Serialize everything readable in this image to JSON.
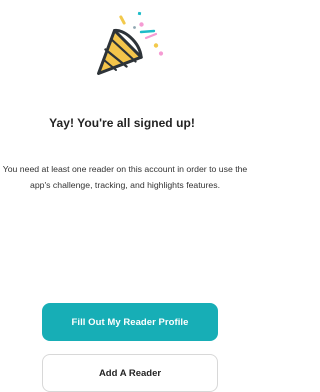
{
  "hero": {
    "icon": "party-popper-icon"
  },
  "content": {
    "title": "Yay! You're all signed up!",
    "message": "You need at least one reader on this account in order to use the app's challenge, tracking, and highlights features."
  },
  "actions": {
    "primary_label": "Fill Out My Reader Profile",
    "secondary_label": "Add A Reader"
  },
  "colors": {
    "primary_button": "#17aeb6",
    "headline": "#232323",
    "body": "#333333"
  }
}
